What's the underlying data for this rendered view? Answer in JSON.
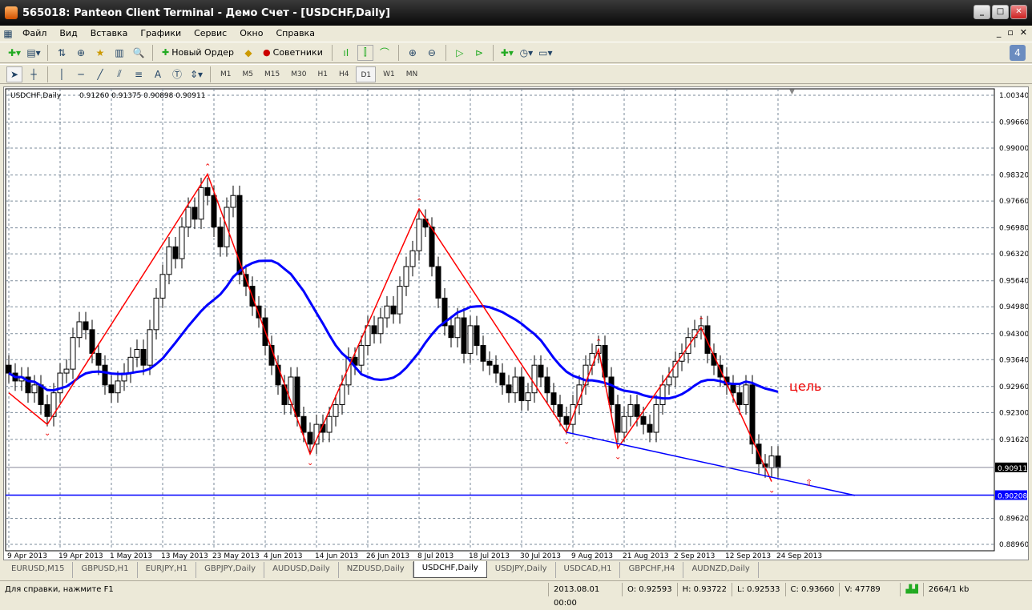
{
  "window": {
    "title": "565018: Panteon Client Terminal - Демо Счет - [USDCHF,Daily]"
  },
  "menu": [
    "Файл",
    "Вид",
    "Вставка",
    "Графики",
    "Сервис",
    "Окно",
    "Справка"
  ],
  "toolbar": {
    "new_order": "Новый Ордер",
    "advisors": "Советники"
  },
  "timeframes": [
    "M1",
    "M5",
    "M15",
    "M30",
    "H1",
    "H4",
    "D1",
    "W1",
    "MN"
  ],
  "active_timeframe": "D1",
  "chart_data": {
    "type": "candlestick",
    "symbol_label": "USDCHF,Daily",
    "ohlc_label": "0.91260 0.91375 0.90898 0.90911",
    "ylim": [
      0.8896,
      1.0034
    ],
    "y_ticks": [
      "1.00340",
      "0.99660",
      "0.99000",
      "0.98320",
      "0.97660",
      "0.96980",
      "0.96320",
      "0.95640",
      "0.94980",
      "0.94300",
      "0.93640",
      "0.92960",
      "0.92300",
      "0.91620",
      "0.90911",
      "0.90208",
      "0.89620",
      "0.88960"
    ],
    "x_ticks": [
      {
        "bar": 0,
        "label": "9 Apr 2013"
      },
      {
        "bar": 8,
        "label": "19 Apr 2013"
      },
      {
        "bar": 16,
        "label": "1 May 2013"
      },
      {
        "bar": 24,
        "label": "13 May 2013"
      },
      {
        "bar": 32,
        "label": "23 May 2013"
      },
      {
        "bar": 40,
        "label": "4 Jun 2013"
      },
      {
        "bar": 48,
        "label": "14 Jun 2013"
      },
      {
        "bar": 56,
        "label": "26 Jun 2013"
      },
      {
        "bar": 64,
        "label": "8 Jul 2013"
      },
      {
        "bar": 72,
        "label": "18 Jul 2013"
      },
      {
        "bar": 80,
        "label": "30 Jul 2013"
      },
      {
        "bar": 88,
        "label": "9 Aug 2013"
      },
      {
        "bar": 96,
        "label": "21 Aug 2013"
      },
      {
        "bar": 104,
        "label": "2 Sep 2013"
      },
      {
        "bar": 112,
        "label": "12 Sep 2013"
      },
      {
        "bar": 120,
        "label": "24 Sep 2013"
      }
    ],
    "closes": [
      0.933,
      0.931,
      0.932,
      0.928,
      0.93,
      0.925,
      0.922,
      0.928,
      0.933,
      0.934,
      0.942,
      0.946,
      0.944,
      0.938,
      0.935,
      0.93,
      0.928,
      0.931,
      0.933,
      0.937,
      0.939,
      0.935,
      0.944,
      0.952,
      0.958,
      0.965,
      0.962,
      0.97,
      0.975,
      0.972,
      0.98,
      0.978,
      0.97,
      0.965,
      0.975,
      0.978,
      0.958,
      0.955,
      0.95,
      0.947,
      0.94,
      0.935,
      0.93,
      0.925,
      0.932,
      0.922,
      0.918,
      0.915,
      0.92,
      0.918,
      0.922,
      0.925,
      0.93,
      0.937,
      0.935,
      0.94,
      0.945,
      0.943,
      0.947,
      0.95,
      0.948,
      0.955,
      0.96,
      0.964,
      0.972,
      0.97,
      0.96,
      0.952,
      0.945,
      0.942,
      0.947,
      0.938,
      0.945,
      0.94,
      0.936,
      0.935,
      0.933,
      0.93,
      0.928,
      0.932,
      0.926,
      0.928,
      0.935,
      0.932,
      0.928,
      0.925,
      0.922,
      0.92,
      0.925,
      0.93,
      0.935,
      0.938,
      0.94,
      0.932,
      0.925,
      0.918,
      0.922,
      0.925,
      0.922,
      0.92,
      0.918,
      0.925,
      0.93,
      0.932,
      0.936,
      0.938,
      0.942,
      0.944,
      0.945,
      0.938,
      0.935,
      0.932,
      0.93,
      0.928,
      0.925,
      0.93,
      0.915,
      0.91,
      0.909,
      0.912,
      0.909
    ],
    "ma_period": 20,
    "zigzag": [
      [
        0,
        0.928
      ],
      [
        6,
        0.92
      ],
      [
        31,
        0.9834
      ],
      [
        47,
        0.9125
      ],
      [
        64,
        0.9746
      ],
      [
        87,
        0.9179
      ],
      [
        92,
        0.939
      ],
      [
        95,
        0.914
      ],
      [
        108,
        0.9445
      ],
      [
        119,
        0.9055
      ]
    ],
    "trendline": [
      [
        87,
        0.918
      ],
      [
        132,
        0.902
      ]
    ],
    "horizontal_level": 0.90208,
    "current_price": 0.90911,
    "annotation": "цель",
    "colors": {
      "zigzag": "#ff0000",
      "ma": "#0000ff",
      "trend": "#0000ff"
    }
  },
  "tabs": [
    "EURUSD,M15",
    "GBPUSD,H1",
    "EURJPY,H1",
    "GBPJPY,Daily",
    "AUDUSD,Daily",
    "NZDUSD,Daily",
    "USDCHF,Daily",
    "USDJPY,Daily",
    "USDCAD,H1",
    "GBPCHF,H4",
    "AUDNZD,Daily"
  ],
  "active_tab": 6,
  "status": {
    "help": "Для справки, нажмите F1",
    "datetime": "2013.08.01 00:00",
    "open": "O: 0.92593",
    "high": "H: 0.93722",
    "low": "L: 0.92533",
    "close": "C: 0.93660",
    "volume": "V: 47789",
    "traffic": "2664/1 kb"
  }
}
